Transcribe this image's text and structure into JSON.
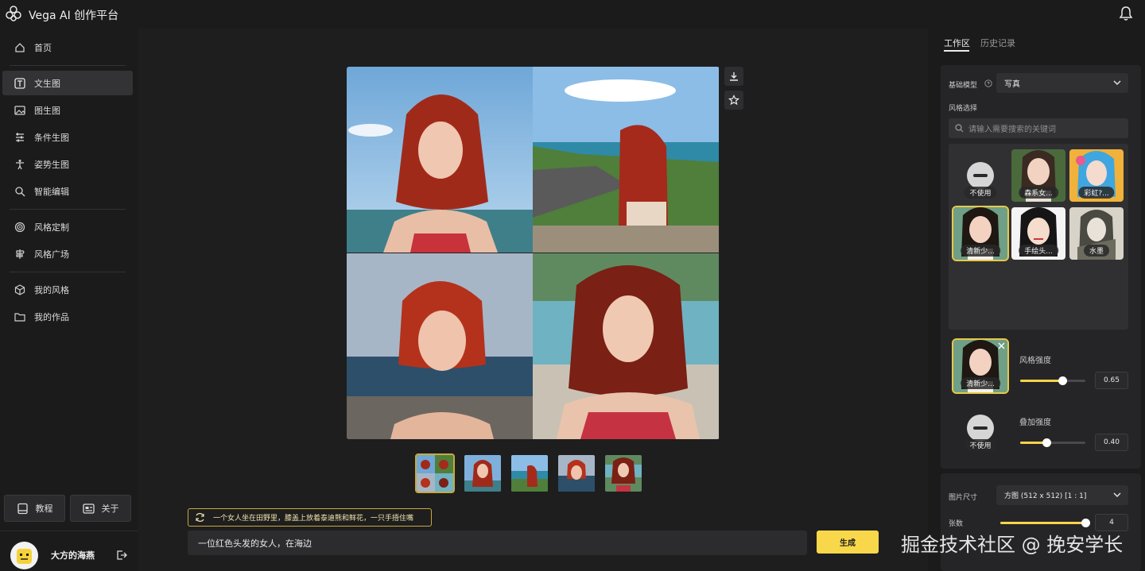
{
  "app": {
    "title": "Vega AI 创作平台"
  },
  "sidebar": {
    "items": [
      {
        "label": "首页",
        "icon": "home-icon"
      },
      {
        "label": "文生图",
        "icon": "text-t-icon"
      },
      {
        "label": "图生图",
        "icon": "image-icon"
      },
      {
        "label": "条件生图",
        "icon": "sliders-icon"
      },
      {
        "label": "姿势生图",
        "icon": "pose-icon"
      },
      {
        "label": "智能编辑",
        "icon": "magic-edit-icon"
      },
      {
        "label": "风格定制",
        "icon": "target-icon"
      },
      {
        "label": "风格广场",
        "icon": "signpost-icon"
      },
      {
        "label": "我的风格",
        "icon": "cube-icon"
      },
      {
        "label": "我的作品",
        "icon": "folder-icon"
      }
    ],
    "tutorial_label": "教程",
    "about_label": "关于",
    "user_name": "大方的海燕"
  },
  "main": {
    "prompt_suggestion": "一个女人坐在田野里，膝盖上放着泰迪熊和鲜花，一只手捂住嘴",
    "prompt_value": "一位红色头发的女人，在海边",
    "generate_label": "生成"
  },
  "panel": {
    "tabs": [
      "工作区",
      "历史记录"
    ],
    "base_model_label": "基础模型",
    "base_model_value": "写真",
    "style_select_label": "风格选择",
    "search_placeholder": "请输入需要搜索的关键词",
    "styles": [
      "不使用",
      "森系女...",
      "彩虹?...",
      "清新少...",
      "手绘头...",
      "水墨"
    ],
    "selected_style": "清新少...",
    "style_strength_label": "风格强度",
    "style_strength_value": "0.65",
    "overlay_style": "不使用",
    "overlay_strength_label": "叠加强度",
    "overlay_strength_value": "0.40",
    "image_size_label": "图片尺寸",
    "image_size_value": "方图  (512 x 512)  [1 : 1]",
    "count_label": "张数",
    "count_value": "4"
  },
  "watermark": "掘金技术社区 @ 挽安学长",
  "colors": {
    "accent": "#f8d84a",
    "selection": "#c9a93c"
  }
}
